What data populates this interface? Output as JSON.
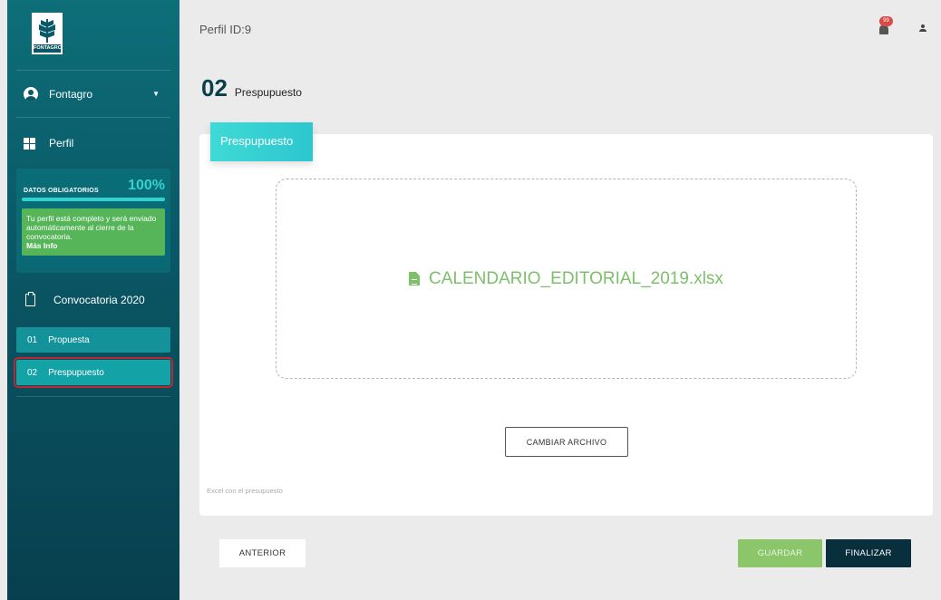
{
  "sidebar": {
    "logo_text": "FONTAGRO",
    "user_name": "Fontagro",
    "perfil_label": "Perfil",
    "datos": {
      "title": "DATOS OBLIGATORIOS",
      "percent_label": "100%",
      "percent_value": 100,
      "message": "Tu perfil está completo y será enviado automáticamente al cierre de la convocatoria.",
      "more_info": "Más Info"
    },
    "convocatoria_label": "Convocatoria 2020",
    "steps": [
      {
        "num": "01",
        "label": "Propuesta"
      },
      {
        "num": "02",
        "label": "Prespupuesto"
      }
    ]
  },
  "header": {
    "perfil_id": "Perfil ID:9",
    "notification_badge": "99"
  },
  "page": {
    "number": "02",
    "title": "Prespupuesto"
  },
  "card": {
    "tab_label": "Prespupuesto",
    "file_name": "CALENDARIO_EDITORIAL_2019.xlsx",
    "change_button": "CAMBIAR ARCHIVO",
    "hint": "Excel con el presupuesto"
  },
  "footer": {
    "prev_label": "ANTERIOR",
    "save_label": "GUARDAR",
    "finish_label": "FINALIZAR"
  },
  "colors": {
    "sidebar": "#0a5866",
    "accent": "#35d1d0",
    "success": "#56b559",
    "file_green": "#7cc06a",
    "dark_button": "#0a2f3c",
    "active_outline": "#c0262d"
  }
}
